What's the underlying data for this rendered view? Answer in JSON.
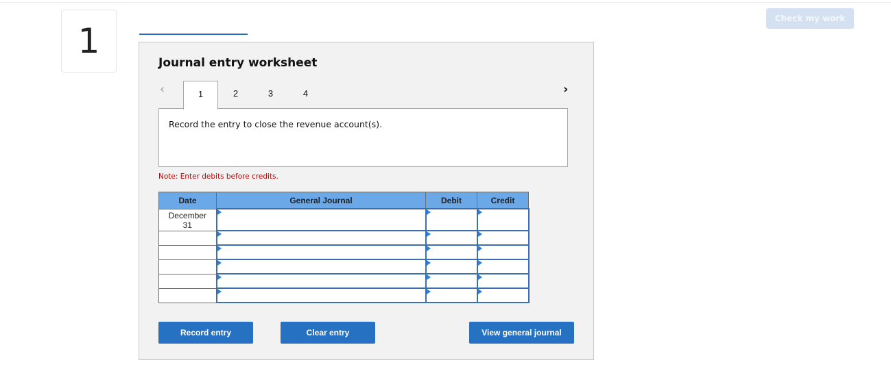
{
  "question": {
    "number": "1"
  },
  "header": {
    "check_button_label": "Check my work"
  },
  "worksheet": {
    "title": "Journal entry worksheet",
    "nav": {
      "prev_icon": "‹",
      "next_icon": "›"
    },
    "tabs": [
      {
        "label": "1",
        "active": true
      },
      {
        "label": "2",
        "active": false
      },
      {
        "label": "3",
        "active": false
      },
      {
        "label": "4",
        "active": false
      }
    ],
    "instruction": "Record the entry to close the revenue account(s).",
    "note": "Note: Enter debits before credits.",
    "table": {
      "columns": [
        "Date",
        "General Journal",
        "Debit",
        "Credit"
      ],
      "rows": [
        {
          "date": "December 31",
          "account": "",
          "debit": "",
          "credit": ""
        },
        {
          "date": "",
          "account": "",
          "debit": "",
          "credit": ""
        },
        {
          "date": "",
          "account": "",
          "debit": "",
          "credit": ""
        },
        {
          "date": "",
          "account": "",
          "debit": "",
          "credit": ""
        },
        {
          "date": "",
          "account": "",
          "debit": "",
          "credit": ""
        },
        {
          "date": "",
          "account": "",
          "debit": "",
          "credit": ""
        }
      ]
    },
    "buttons": {
      "record": "Record entry",
      "clear": "Clear entry",
      "view": "View general journal"
    }
  },
  "colors": {
    "primary_button": "#2671c1",
    "header_fill": "#6aa8e8",
    "note_text": "#c00000",
    "disabled_button": "#d3e1f2"
  }
}
